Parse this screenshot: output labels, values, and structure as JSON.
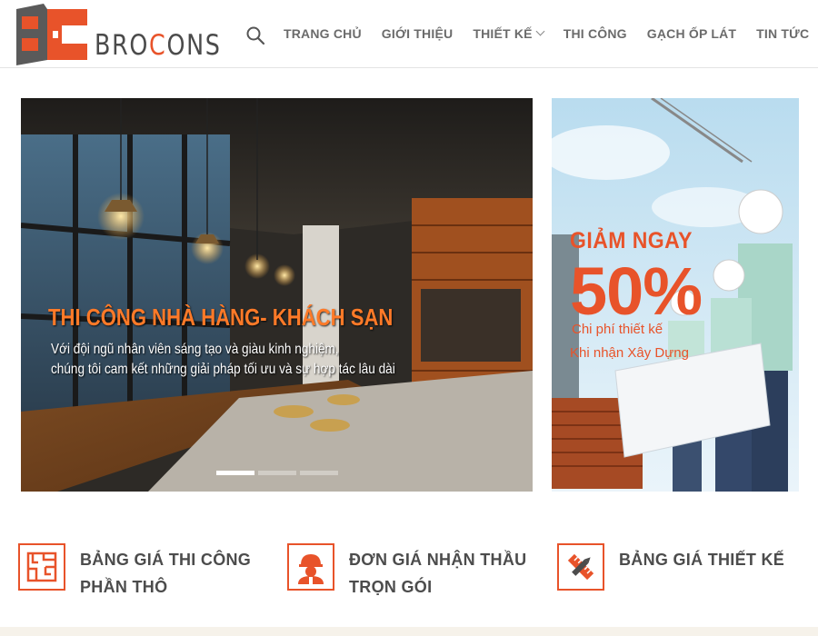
{
  "header": {
    "logo_text_a": "BRO",
    "logo_text_c": "C",
    "logo_text_b": "ONS",
    "search_icon": "search-icon",
    "nav": [
      {
        "label": "TRANG CHỦ"
      },
      {
        "label": "GIỚI THIỆU"
      },
      {
        "label": "THIẾT KẾ",
        "dropdown": true
      },
      {
        "label": "THI CÔNG"
      },
      {
        "label": "GẠCH ỐP LÁT"
      },
      {
        "label": "TIN TỨC"
      }
    ]
  },
  "slider": {
    "title": "THI CÔNG NHÀ HÀNG- KHÁCH SẠN",
    "line1": "Với đội ngũ nhân viên sáng tạo và giàu kinh nghiệm,",
    "line2": "chúng tôi cam kết những giải pháp tối ưu và sự hợp tác lâu dài",
    "active_slide": 1,
    "slide_count": 3
  },
  "promo": {
    "headline": "GIẢM NGAY",
    "percent": "50%",
    "line1": "Chi phí thiết kế",
    "line2": "Khi nhận Xây Dựng"
  },
  "features": [
    {
      "line1": "BẢNG GIÁ THI CÔNG",
      "line2": "PHẦN THÔ",
      "icon": "floorplan-icon"
    },
    {
      "line1": "ĐƠN GIÁ NHẬN THẦU",
      "line2": "TRỌN GÓI",
      "icon": "worker-icon"
    },
    {
      "line1": "BẢNG GIÁ THIẾT KẾ",
      "line2": "",
      "icon": "pencil-ruler-icon"
    }
  ],
  "colors": {
    "accent": "#e8532a",
    "nav_text": "#6b6b6b",
    "feature_text": "#4c4c4c"
  }
}
